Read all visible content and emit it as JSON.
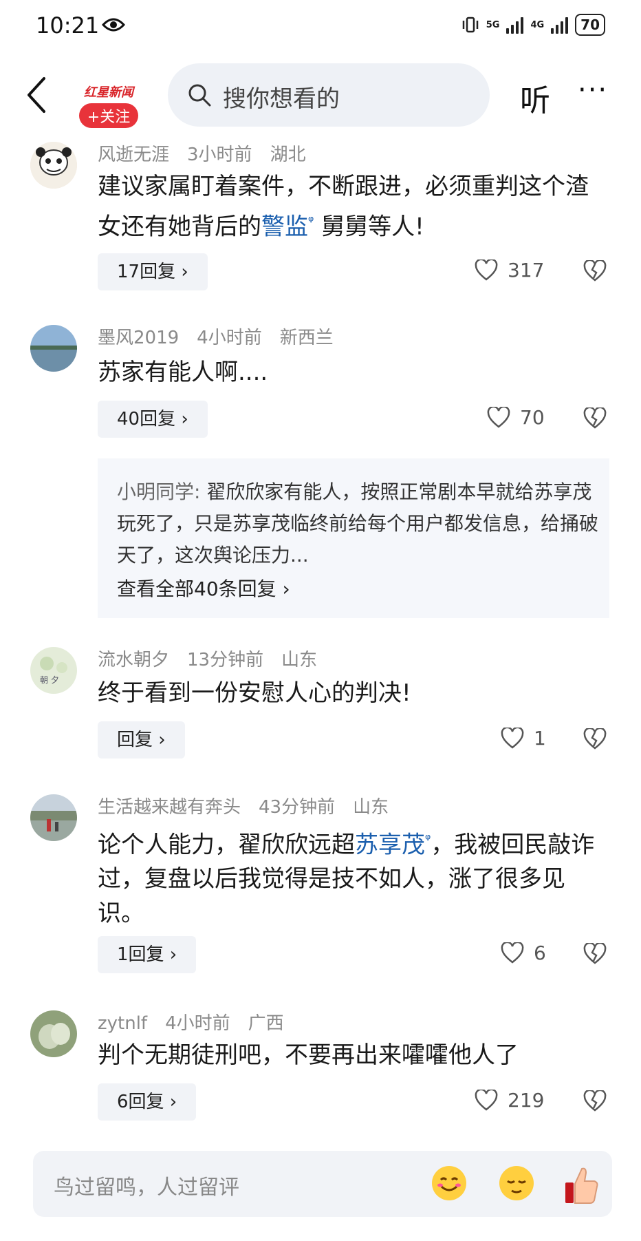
{
  "status_bar": {
    "time": "10:21",
    "net1": "5G",
    "net2": "4G",
    "battery": "70"
  },
  "header": {
    "brand": "红星新闻",
    "follow_label": "+关注",
    "search_placeholder": "搜你想看的",
    "listen_label": "听",
    "more_label": "···"
  },
  "comments": [
    {
      "user": "风逝无涯",
      "time": "3小时前",
      "location": "湖北",
      "text_before": "建议家属盯着案件，不断跟进，必须重判这个渣女还有她背后的",
      "link": "警监",
      "text_after": "舅舅等人!",
      "reply_label": "17回复 ›",
      "likes": "317"
    },
    {
      "user": "墨风2019",
      "time": "4小时前",
      "location": "新西兰",
      "text": "苏家有能人啊....",
      "reply_label": "40回复 ›",
      "likes": "70",
      "sub_author": "小明同学:",
      "sub_text": " 翟欣欣家有能人，按照正常剧本早就给苏享茂玩死了，只是苏享茂临终前给每个用户都发信息，给捅破天了，这次舆论压力...",
      "view_all": "查看全部40条回复 ›"
    },
    {
      "user": "流水朝夕",
      "time": "13分钟前",
      "location": "山东",
      "text": "终于看到一份安慰人心的判决!",
      "reply_label": "回复 ›",
      "likes": "1"
    },
    {
      "user": "生活越来越有奔头",
      "time": "43分钟前",
      "location": "山东",
      "text_before": "论个人能力，翟欣欣远超",
      "link": "苏享茂",
      "text_after": "，我被回民敲诈过，复盘以后我觉得是技不如人，涨了很多见识。",
      "reply_label": "1回复 ›",
      "likes": "6"
    },
    {
      "user": "zytnlf",
      "time": "4小时前",
      "location": "广西",
      "text": "判个无期徒刑吧，不要再出来嚯嚯他人了",
      "reply_label": "6回复 ›",
      "likes": "219"
    }
  ],
  "composer": {
    "placeholder": "鸟过留鸣，人过留评"
  },
  "colors": {
    "link": "#1b5fae",
    "accent": "#e8333a"
  }
}
